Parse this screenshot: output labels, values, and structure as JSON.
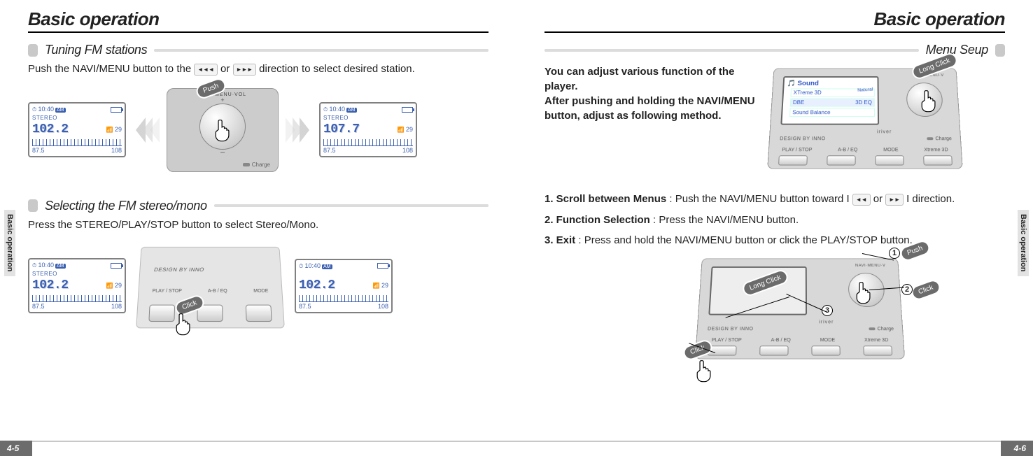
{
  "left": {
    "title": "Basic operation",
    "section1": {
      "heading": "Tuning FM stations",
      "body_pre": "Push the NAVI/MENU button to the ",
      "body_mid": " or ",
      "body_post": " direction to select desired station.",
      "icon_prev": "◂◂◂",
      "icon_next": "▸▸▸"
    },
    "section2": {
      "heading": "Selecting the FM stereo/mono",
      "body": "Press the STEREO/PLAY/STOP button to select Stereo/Mono."
    },
    "lcd": {
      "time": "10:40",
      "ampm": "AM",
      "stereo": "STEREO",
      "freq1": "102.2",
      "freq2": "107.7",
      "vol": "29",
      "range_lo": "87.5",
      "range_hi": "108"
    },
    "knob": {
      "arc": "NAVI·MENU·VOL",
      "charge": "Charge"
    },
    "btn_device": {
      "brand": "DESIGN BY INNO",
      "labels": [
        "PLAY / STOP",
        "A-B / EQ",
        "MODE"
      ]
    },
    "callouts": {
      "push": "Push",
      "click": "Click"
    },
    "side_tab": "Basic operation",
    "page_num": "4-5"
  },
  "right": {
    "title": "Basic operation",
    "section": {
      "heading": "Menu Seup"
    },
    "intro_lines": [
      "You can adjust various function of the player.",
      "After pushing and holding the NAVI/MENU button, adjust as following method."
    ],
    "menu_screen": {
      "title": "Sound",
      "items": [
        [
          "XTreme 3D",
          ""
        ],
        [
          "DBE",
          "3D EQ"
        ],
        [
          "Sound Balance",
          ""
        ]
      ],
      "natural": "Natural"
    },
    "device": {
      "arc": "NAVI·MENU·V",
      "charge": "Charge",
      "brand": "DESIGN BY INNO",
      "brand2": "iriver",
      "labels": [
        "PLAY / STOP",
        "A-B / EQ",
        "MODE",
        "Xtreme 3D"
      ]
    },
    "steps": {
      "s1_a": "1. Scroll between Menus",
      "s1_b": " : Push the NAVI/MENU button toward I",
      "s1_mid": "  or  ",
      "s1_c": "I direction.",
      "s2_a": "2. Function Selection",
      "s2_b": " : Press the NAVI/MENU button.",
      "s3_a": "3. Exit",
      "s3_b": " : Press and hold the NAVI/MENU button or click the PLAY/STOP button.",
      "icon_prev": "◂◂",
      "icon_next": "▸▸"
    },
    "callouts": {
      "long_click": "Long Click",
      "click": "Click",
      "push": "Push"
    },
    "badges": {
      "n1": "1",
      "n2": "2",
      "n3": "3"
    },
    "side_tab": "Basic operation",
    "page_num": "4-6"
  }
}
